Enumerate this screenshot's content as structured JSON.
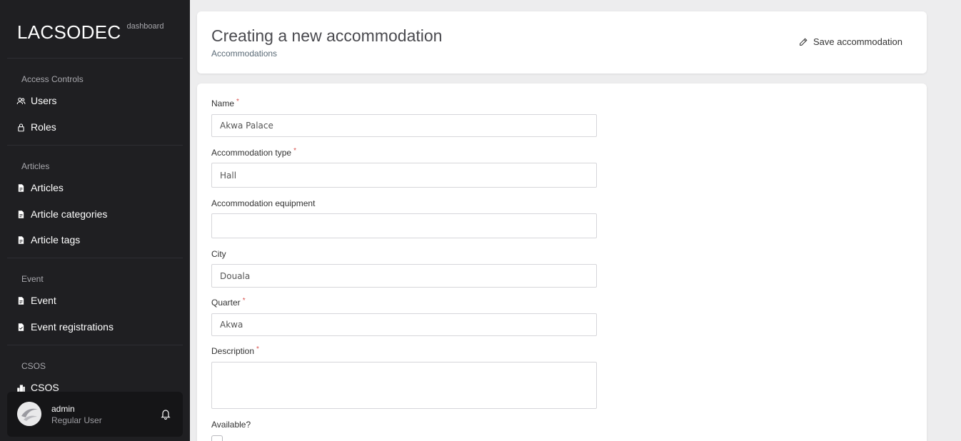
{
  "brand": {
    "name": "LACSODEC",
    "sub": "dashboard"
  },
  "sidebar": {
    "sections": [
      {
        "title": "Access Controls",
        "items": [
          {
            "label": "Users",
            "icon": "users-icon"
          },
          {
            "label": "Roles",
            "icon": "lock-icon"
          }
        ]
      },
      {
        "title": "Articles",
        "items": [
          {
            "label": "Articles",
            "icon": "document-icon"
          },
          {
            "label": "Article categories",
            "icon": "document-icon"
          },
          {
            "label": "Article tags",
            "icon": "document-icon"
          }
        ]
      },
      {
        "title": "Event",
        "items": [
          {
            "label": "Event",
            "icon": "document-icon"
          },
          {
            "label": "Event registrations",
            "icon": "document-check-icon"
          }
        ]
      },
      {
        "title": "CSOS",
        "items": [
          {
            "label": "CSOS",
            "icon": "building-icon"
          }
        ]
      }
    ]
  },
  "user": {
    "name": "admin",
    "role": "Regular User"
  },
  "header": {
    "title": "Creating a new accommodation",
    "breadcrumb": "Accommodations",
    "save_label": "Save accommodation"
  },
  "form": {
    "required_mark": "*",
    "name": {
      "label": "Name",
      "value": "Akwa Palace"
    },
    "type": {
      "label": "Accommodation type",
      "value": "Hall"
    },
    "equipment": {
      "label": "Accommodation equipment",
      "value": ""
    },
    "city": {
      "label": "City",
      "value": "Douala"
    },
    "quarter": {
      "label": "Quarter",
      "value": "Akwa"
    },
    "description": {
      "label": "Description",
      "value": ""
    },
    "available": {
      "label": "Available?",
      "checked": false
    }
  },
  "colors": {
    "sidebar_bg": "#1f1f22",
    "page_bg": "#ededee",
    "required": "#d9534f"
  }
}
